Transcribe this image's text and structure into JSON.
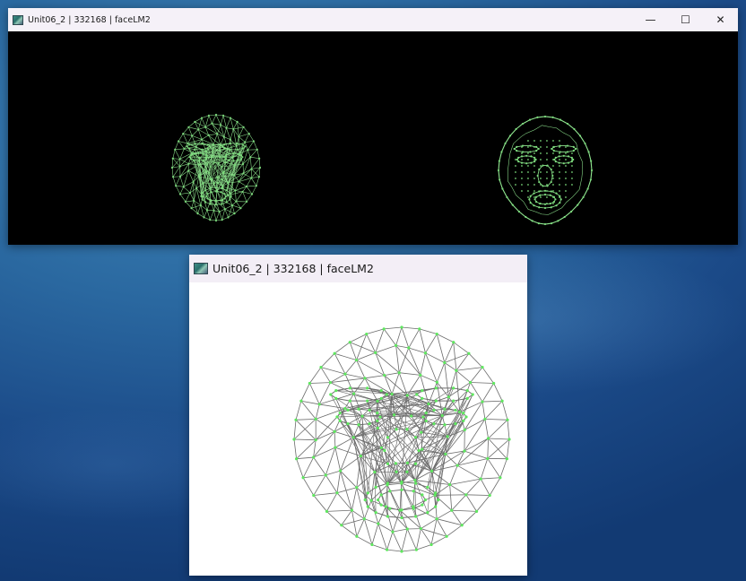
{
  "windows": [
    {
      "title": "Unit06_2 | 332168 | faceLM2",
      "controls": {
        "minimize": "—",
        "maximize": "☐",
        "close": "✕"
      },
      "panels": [
        "face-mesh-left",
        "face-mesh-right"
      ]
    },
    {
      "title": "Unit06_2 | 332168 | faceLM2"
    }
  ],
  "colors": {
    "mesh_on_black": "#8fe58f",
    "landmark_on_black": "#7ddc7d",
    "mesh_on_white": "#6a6a6a",
    "landmark_on_white": "#5fe85f",
    "titlebar": "#f5f1f8"
  }
}
